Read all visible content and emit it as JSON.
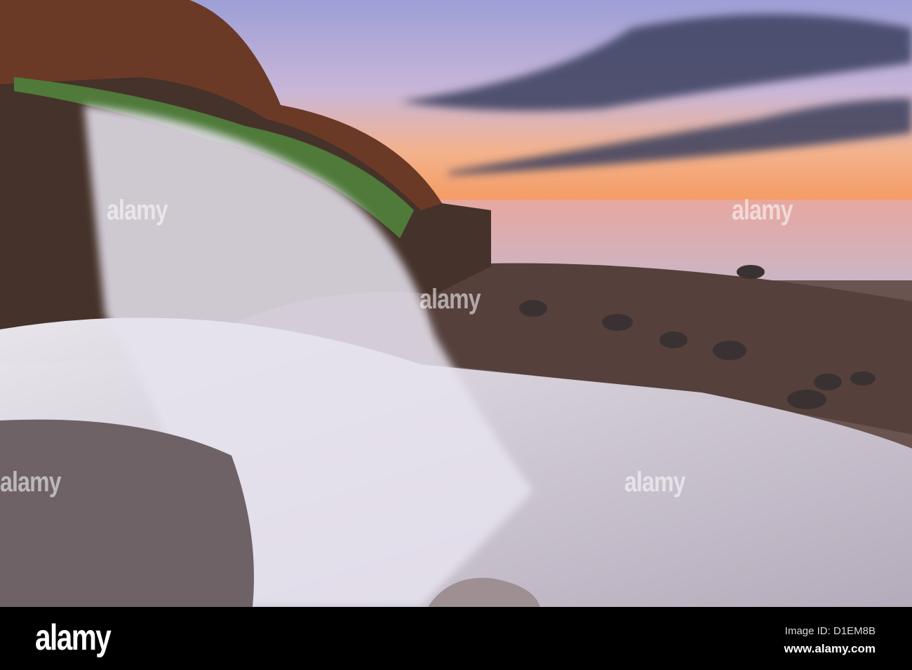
{
  "watermark": {
    "text": "alamy"
  },
  "footer": {
    "logo": "alamy",
    "image_id": "Image ID: D1EM8B",
    "website": "www.alamy.com"
  },
  "colors": {
    "sky_top": "#a7a6d8",
    "sunset": "#f6a26a",
    "sea": "#e0a6a0",
    "rock": "#4a3c35",
    "water": "#d8d4e4"
  }
}
